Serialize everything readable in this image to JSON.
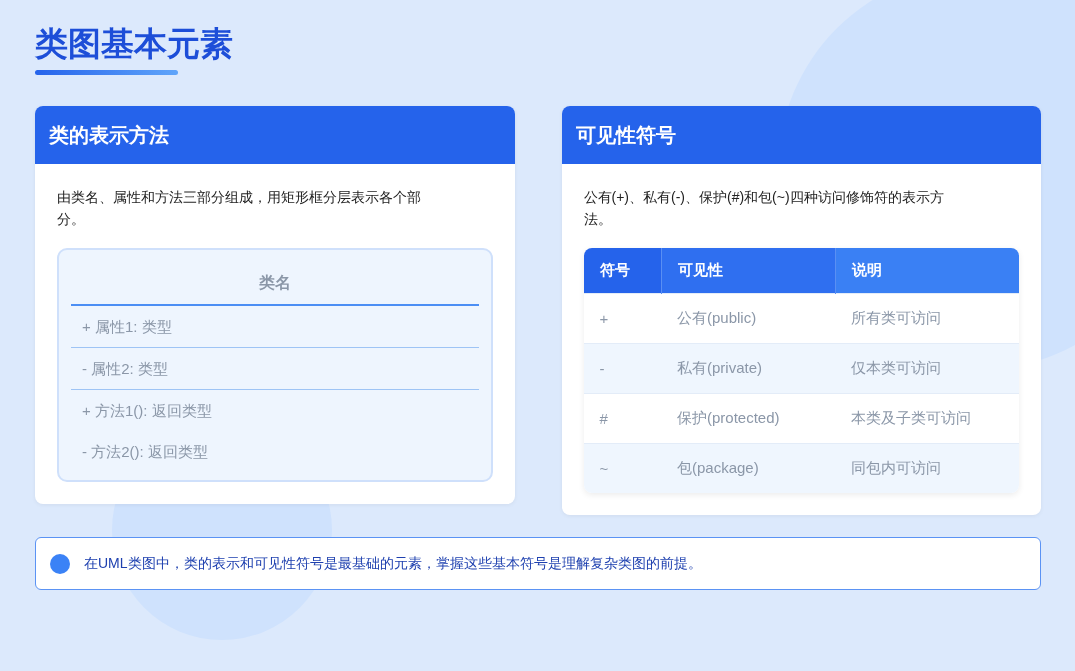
{
  "title": "类图基本元素",
  "class_card": {
    "title": "类的表示方法",
    "description": "由类名、属性和方法三部分组成，用矩形框分层表示各个部分。",
    "diagram": {
      "name": "类名",
      "attributes": [
        "+ 属性1: 类型",
        "- 属性2: 类型"
      ],
      "methods": [
        "+ 方法1(): 返回类型",
        "- 方法2(): 返回类型"
      ]
    }
  },
  "visibility_card": {
    "title": "可见性符号",
    "description": "公有(+)、私有(-)、保护(#)和包(~)四种访问修饰符的表示方法。",
    "table": {
      "columns": [
        "符号",
        "可见性",
        "说明"
      ],
      "rows": [
        [
          "+",
          "公有(public)",
          "所有类可访问"
        ],
        [
          "-",
          "私有(private)",
          "仅本类可访问"
        ],
        [
          "#",
          "保护(protected)",
          "本类及子类可访问"
        ],
        [
          "~",
          "包(package)",
          "同包内可访问"
        ]
      ]
    }
  },
  "note": "在UML类图中，类的表示和可见性符号是最基础的元素，掌握这些基本符号是理解复杂类图的前提。"
}
